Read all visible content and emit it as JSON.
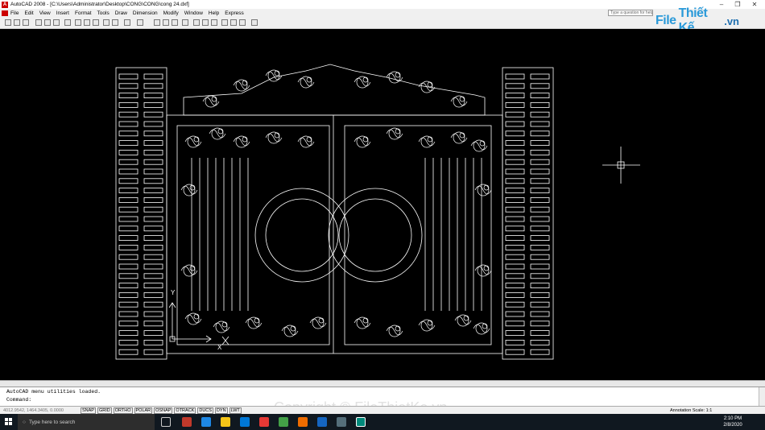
{
  "titlebar": {
    "title": "AutoCAD 2008 - [C:\\Users\\Administrator\\Desktop\\CONG\\CONG\\cong 24.dxf]"
  },
  "menu": [
    "File",
    "Edit",
    "View",
    "Insert",
    "Format",
    "Tools",
    "Draw",
    "Dimension",
    "Modify",
    "Window",
    "Help",
    "Express"
  ],
  "help": {
    "placeholder": "Type a question for help"
  },
  "logo": {
    "file": "File",
    "name": "Thiết Kế",
    "domain": ".vn"
  },
  "command": {
    "line1": "AutoCAD menu utilities loaded.",
    "line2": "Command:"
  },
  "status": {
    "coords": "4012.9542, 1464.3405, 0.0000",
    "toggles": [
      "SNAP",
      "GRID",
      "ORTHO",
      "POLAR",
      "OSNAP",
      "OTRACK",
      "DUCS",
      "DYN",
      "LWT"
    ],
    "annotation": "Annotation Scale: 1:1"
  },
  "taskbar": {
    "search": "Type here to search",
    "time": "2:10 PM",
    "date": "2/8/2020"
  },
  "watermark": "Copyright © FileThietKe.vn",
  "colors": {
    "canvas": "#000000",
    "lines": "#ffffff",
    "accent": "#2b9ad9"
  }
}
